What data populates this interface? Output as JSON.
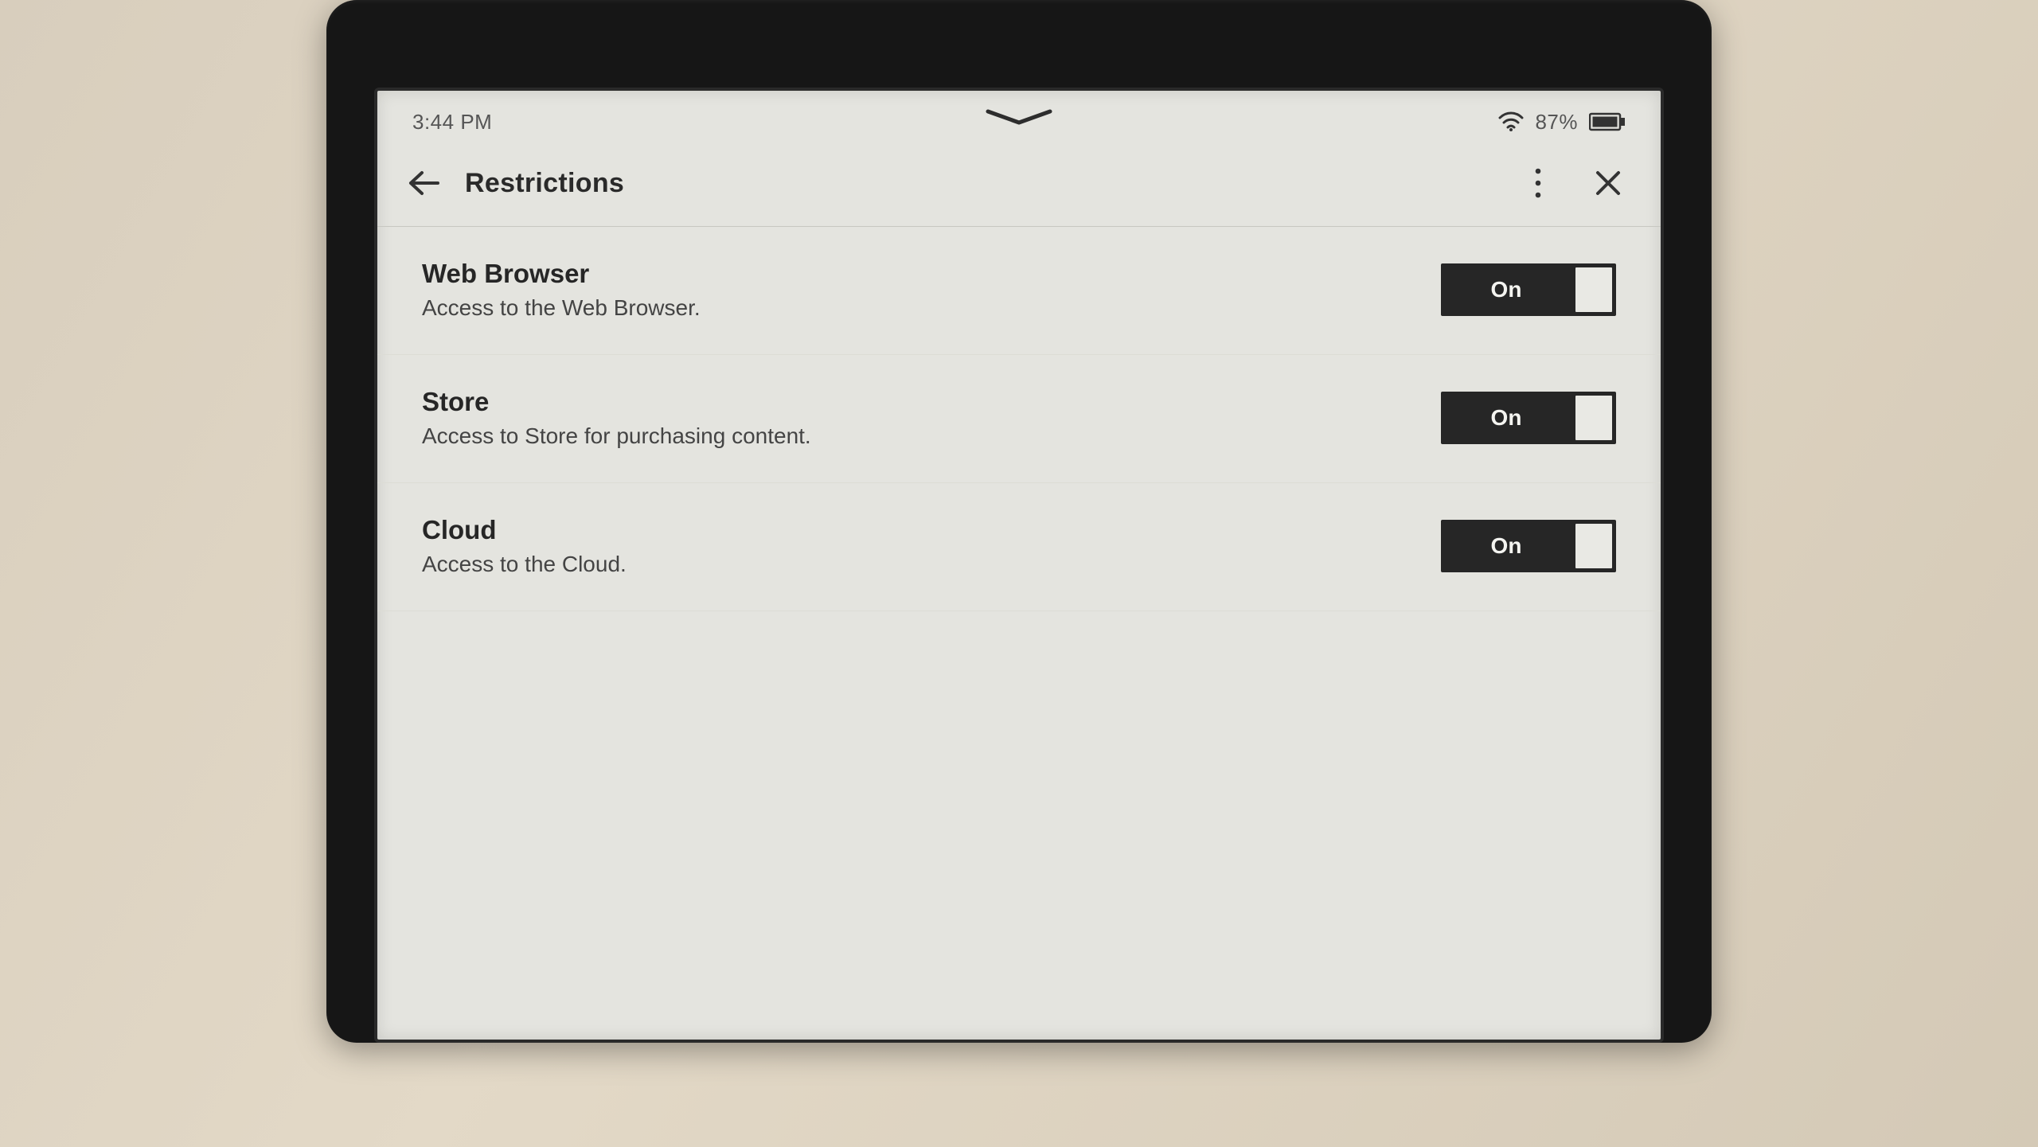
{
  "status": {
    "time": "3:44 PM",
    "battery_percent": "87%"
  },
  "header": {
    "title": "Restrictions"
  },
  "settings": {
    "rows": [
      {
        "title": "Web Browser",
        "desc": "Access to the Web Browser.",
        "toggle": "On"
      },
      {
        "title": "Store",
        "desc": "Access to Store for purchasing content.",
        "toggle": "On"
      },
      {
        "title": "Cloud",
        "desc": "Access to the Cloud.",
        "toggle": "On"
      }
    ]
  }
}
